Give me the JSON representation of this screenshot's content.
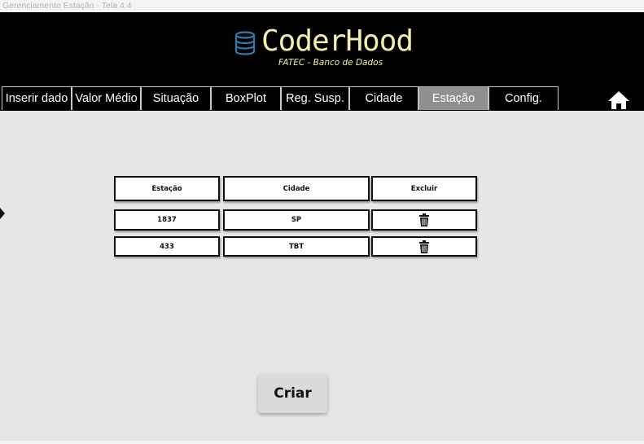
{
  "window": {
    "title": "Gerenciamento Estação - Tela 4.4"
  },
  "header": {
    "brand": "CoderHood",
    "subtitle": "FATEC - Banco de Dados",
    "logo_icon": "database-icon",
    "home_icon": "home-icon"
  },
  "tabs": [
    {
      "label": "Inserir dado",
      "active": false
    },
    {
      "label": "Valor Médio",
      "active": false
    },
    {
      "label": "Situação",
      "active": false
    },
    {
      "label": "BoxPlot",
      "active": false
    },
    {
      "label": "Reg. Susp.",
      "active": false
    },
    {
      "label": "Cidade",
      "active": false
    },
    {
      "label": "Estação",
      "active": true
    },
    {
      "label": "Config.",
      "active": false
    }
  ],
  "table": {
    "headers": [
      "Estação",
      "Cidade",
      "Excluir"
    ],
    "rows": [
      {
        "estacao": "1837",
        "cidade": "SP",
        "delete_icon": "trash-icon"
      },
      {
        "estacao": "433",
        "cidade": "TBT",
        "delete_icon": "trash-icon"
      }
    ]
  },
  "actions": {
    "create_label": "Criar"
  },
  "colors": {
    "header_bg": "#000000",
    "brand_text": "#f2f0a8",
    "logo_icon": "#2e7bb0",
    "active_tab": "#8f8f8f",
    "content_bg": "#e6e6e6"
  }
}
